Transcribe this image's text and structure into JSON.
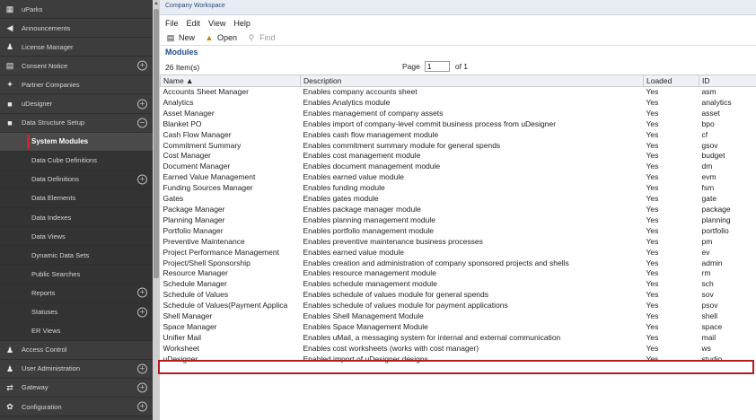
{
  "sidebar": {
    "items": [
      {
        "label": "uParks",
        "icon": "grid-icon",
        "plus": false,
        "kind": "top"
      },
      {
        "label": "Announcements",
        "icon": "megaphone-icon",
        "plus": false,
        "kind": "top"
      },
      {
        "label": "License Manager",
        "icon": "users-icon",
        "plus": false,
        "kind": "top"
      },
      {
        "label": "Consent Notice",
        "icon": "document-icon",
        "plus": true,
        "kind": "top"
      },
      {
        "label": "Partner Companies",
        "icon": "handshake-icon",
        "plus": false,
        "kind": "top"
      },
      {
        "label": "uDesigner",
        "icon": "square-icon",
        "plus": true,
        "kind": "top"
      },
      {
        "label": "Data Structure Setup",
        "icon": "square-icon",
        "plus": false,
        "minus": true,
        "kind": "top"
      },
      {
        "label": "System Modules",
        "plus": false,
        "kind": "sub",
        "active": true
      },
      {
        "label": "Data Cube Definitions",
        "plus": false,
        "kind": "sub"
      },
      {
        "label": "Data Definitions",
        "plus": true,
        "kind": "sub"
      },
      {
        "label": "Data Elements",
        "plus": false,
        "kind": "sub"
      },
      {
        "label": "Data Indexes",
        "plus": false,
        "kind": "sub"
      },
      {
        "label": "Data Views",
        "plus": false,
        "kind": "sub"
      },
      {
        "label": "Dynamic Data Sets",
        "plus": false,
        "kind": "sub"
      },
      {
        "label": "Public Searches",
        "plus": false,
        "kind": "sub"
      },
      {
        "label": "Reports",
        "plus": true,
        "kind": "sub"
      },
      {
        "label": "Statuses",
        "plus": true,
        "kind": "sub"
      },
      {
        "label": "ER Views",
        "plus": false,
        "kind": "sub"
      },
      {
        "label": "Access Control",
        "icon": "users-icon",
        "plus": false,
        "kind": "top"
      },
      {
        "label": "User Administration",
        "icon": "users-icon",
        "plus": true,
        "kind": "top"
      },
      {
        "label": "Gateway",
        "icon": "arrows-icon",
        "plus": true,
        "kind": "top"
      },
      {
        "label": "Configuration",
        "icon": "gear-icon",
        "plus": true,
        "kind": "top"
      }
    ]
  },
  "workspace": {
    "title": "Company Workspace"
  },
  "menu": {
    "file": "File",
    "edit": "Edit",
    "view": "View",
    "help": "Help"
  },
  "toolbar": {
    "new_label": "New",
    "open_label": "Open",
    "find_label": "Find"
  },
  "modules": {
    "title": "Modules",
    "count_label": "26 Item(s)",
    "page_label": "Page",
    "page_value": "1",
    "of_label": "of 1"
  },
  "table": {
    "columns": [
      "Name ▲",
      "Description",
      "Loaded",
      "ID"
    ],
    "rows": [
      [
        "Accounts Sheet Manager",
        "Enables company accounts sheet",
        "Yes",
        "asm"
      ],
      [
        "Analytics",
        "Enables Analytics module",
        "Yes",
        "analytics"
      ],
      [
        "Asset Manager",
        "Enables management of company assets",
        "Yes",
        "asset"
      ],
      [
        "Blanket PO",
        "Enables import of company-level commit business process from uDesigner",
        "Yes",
        "bpo"
      ],
      [
        "Cash Flow Manager",
        "Enables cash flow management module",
        "Yes",
        "cf"
      ],
      [
        "Commitment Summary",
        "Enables commitment summary module for general spends",
        "Yes",
        "gsov"
      ],
      [
        "Cost Manager",
        "Enables cost management module",
        "Yes",
        "budget"
      ],
      [
        "Document Manager",
        "Enables document management module",
        "Yes",
        "dm"
      ],
      [
        "Earned Value Management",
        "Enables earned value module",
        "Yes",
        "evm"
      ],
      [
        "Funding Sources Manager",
        "Enables funding module",
        "Yes",
        "fsm"
      ],
      [
        "Gates",
        "Enables gates module",
        "Yes",
        "gate"
      ],
      [
        "Package Manager",
        "Enables package manager module",
        "Yes",
        "package"
      ],
      [
        "Planning Manager",
        "Enables planning management module",
        "Yes",
        "planning"
      ],
      [
        "Portfolio Manager",
        "Enables portfolio management module",
        "Yes",
        "portfolio"
      ],
      [
        "Preventive Maintenance",
        "Enables preventive maintenance business processes",
        "Yes",
        "pm"
      ],
      [
        "Project Performance Management",
        "Enables earned value module",
        "Yes",
        "ev"
      ],
      [
        "Project/Shell Sponsorship",
        "Enables creation and administration of company sponsored projects and shells",
        "Yes",
        "admin"
      ],
      [
        "Resource Manager",
        "Enables resource management module",
        "Yes",
        "rm"
      ],
      [
        "Schedule Manager",
        "Enables schedule management module",
        "Yes",
        "sch"
      ],
      [
        "Schedule of Values",
        "Enables schedule of values module for general spends",
        "Yes",
        "sov"
      ],
      [
        "Schedule of Values(Payment Applica",
        "Enables schedule of values module for payment applications",
        "Yes",
        "psov"
      ],
      [
        "Shell Manager",
        "Enables Shell Management Module",
        "Yes",
        "shell"
      ],
      [
        "Space Manager",
        "Enables Space Management Module",
        "Yes",
        "space"
      ],
      [
        "Unifier Mail",
        "Enables uMail, a messaging system for internal and external communication",
        "Yes",
        "mail"
      ],
      [
        "Worksheet",
        "Enables cost worksheets (works with cost manager)",
        "Yes",
        "ws"
      ],
      [
        "uDesigner",
        "Enabled import of uDesigner designs",
        "Yes",
        "studio"
      ]
    ],
    "highlighted_row": "Project Performance Management"
  },
  "colors": {
    "accent": "#b21d22",
    "sidebar_bg": "#3a3a3a",
    "title_blue": "#1f4e8c"
  }
}
